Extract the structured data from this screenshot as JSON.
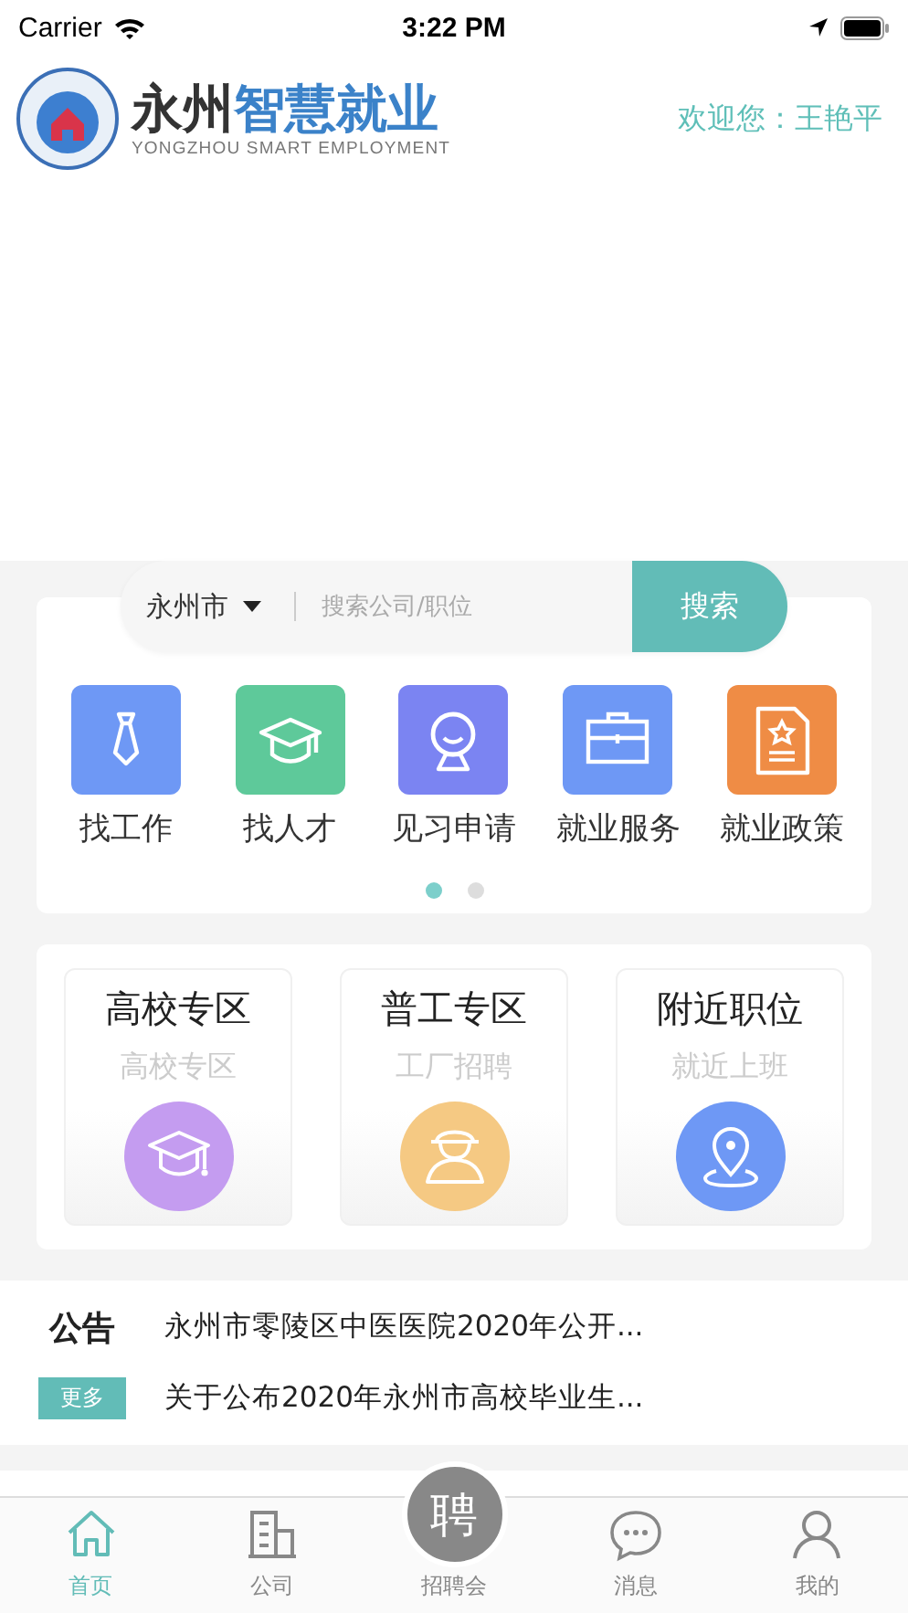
{
  "status_bar": {
    "carrier": "Carrier",
    "time": "3:22 PM"
  },
  "header": {
    "logo_title_dark": "永州",
    "logo_title_blue": "智慧就业",
    "logo_subtitle": "YONGZHOU SMART EMPLOYMENT",
    "welcome": "欢迎您：",
    "user": "王艳平"
  },
  "search": {
    "city": "永州市",
    "placeholder": "搜索公司/职位",
    "button": "搜索"
  },
  "quick_menu": [
    {
      "label": "找工作",
      "kind": "tie",
      "color": "#6e98f5"
    },
    {
      "label": "找人才",
      "kind": "cap",
      "color": "#5ec99a"
    },
    {
      "label": "见习申请",
      "kind": "webcam",
      "color": "#7b84f2"
    },
    {
      "label": "就业服务",
      "kind": "briefcase",
      "color": "#6e98f5"
    },
    {
      "label": "就业政策",
      "kind": "document",
      "color": "#ef8c45"
    }
  ],
  "pager": [
    {
      "selected": true
    },
    {
      "selected": false
    }
  ],
  "zones": [
    {
      "title": "高校专区",
      "subtitle": "高校专区",
      "kind": "cap",
      "color": "#c49cf0"
    },
    {
      "title": "普工专区",
      "subtitle": "工厂招聘",
      "kind": "worker",
      "color": "#f5c983"
    },
    {
      "title": "附近职位",
      "subtitle": "就近上班",
      "kind": "pin",
      "color": "#6e98f5"
    }
  ],
  "notices": {
    "title": "公告",
    "more": "更多",
    "items": [
      "永州市零陵区中医医院2020年公开...",
      "关于公布2020年永州市高校毕业生..."
    ]
  },
  "tab_bar": [
    {
      "label": "首页",
      "kind": "home",
      "selected": true
    },
    {
      "label": "公司",
      "kind": "building",
      "selected": false
    },
    {
      "label": "招聘会",
      "kind": "center",
      "badge": "聘",
      "selected": false
    },
    {
      "label": "消息",
      "kind": "chat",
      "selected": false
    },
    {
      "label": "我的",
      "kind": "person",
      "selected": false
    }
  ]
}
